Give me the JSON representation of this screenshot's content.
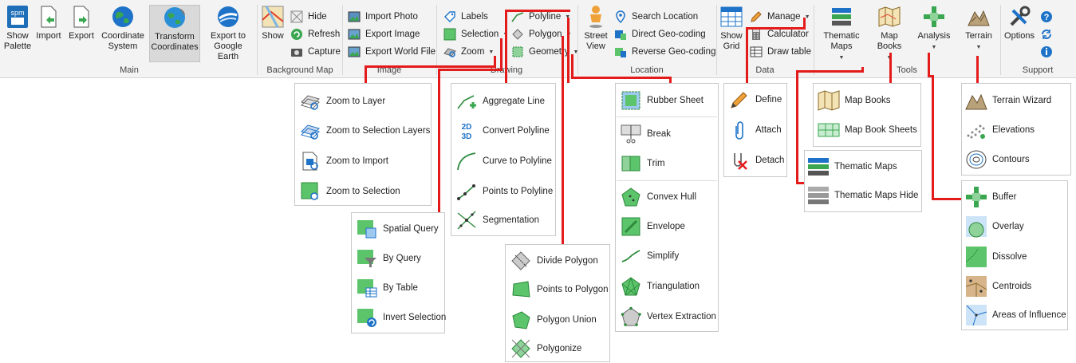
{
  "ribbon": {
    "groups": {
      "main": "Main",
      "background_map": "Background Map",
      "image": "Image",
      "drawing": "Drawing",
      "location": "Location",
      "data": "Data",
      "tools": "Tools",
      "support": "Support"
    },
    "main": {
      "show_palette": "Show Palette",
      "import": "Import",
      "export": "Export",
      "coordinate_system": "Coordinate System",
      "transform_coordinates": "Transform Coordinates",
      "export_google_earth": "Export to Google Earth"
    },
    "background_map": {
      "show": "Show",
      "hide": "Hide",
      "refresh": "Refresh",
      "capture": "Capture"
    },
    "image": {
      "import_photo": "Import Photo",
      "export_image": "Export Image",
      "export_world_file": "Export World File"
    },
    "drawing": {
      "labels": "Labels",
      "selection": "Selection",
      "zoom": "Zoom",
      "polyline": "Polyline",
      "polygon": "Polygon",
      "geometry": "Geometry"
    },
    "location": {
      "street_view": "Street View",
      "search_location": "Search Location",
      "direct_geocoding": "Direct Geo-coding",
      "reverse_geocoding": "Reverse Geo-coding"
    },
    "data": {
      "show_grid": "Show Grid",
      "manage": "Manage",
      "calculator": "Calculator",
      "draw_table": "Draw table"
    },
    "tools": {
      "thematic_maps": "Thematic Maps",
      "map_books": "Map Books",
      "analysis": "Analysis",
      "terrain": "Terrain"
    },
    "support": {
      "options": "Options"
    }
  },
  "menus": {
    "zoom": [
      "Zoom to Layer",
      "Zoom to Selection Layers",
      "Zoom to Import",
      "Zoom to Selection"
    ],
    "selection": [
      "Spatial Query",
      "By Query",
      "By Table",
      "Invert Selection"
    ],
    "polyline": [
      "Aggregate Line",
      "Convert Polyline",
      "Curve to Polyline",
      "Points to Polyline",
      "Segmentation"
    ],
    "polygon": [
      "Divide Polygon",
      "Points to Polygon",
      "Polygon Union",
      "Polygonize"
    ],
    "geometry": [
      "Rubber Sheet",
      "Break",
      "Trim",
      "Convex Hull",
      "Envelope",
      "Simplify",
      "Triangulation",
      "Vertex Extraction"
    ],
    "manage": [
      "Define",
      "Attach",
      "Detach"
    ],
    "map_books": [
      "Map Books",
      "Map Book Sheets"
    ],
    "thematic_maps": [
      "Thematic Maps",
      "Thematic Maps Hide"
    ],
    "terrain": [
      "Terrain Wizard",
      "Elevations",
      "Contours"
    ],
    "analysis": [
      "Buffer",
      "Overlay",
      "Dissolve",
      "Centroids",
      "Areas of Influence"
    ]
  },
  "colors": {
    "connector": "#e31b1b",
    "accent_blue": "#1e73c8",
    "accent_green": "#3aa650",
    "ribbon_bg": "#f3f3f3"
  }
}
